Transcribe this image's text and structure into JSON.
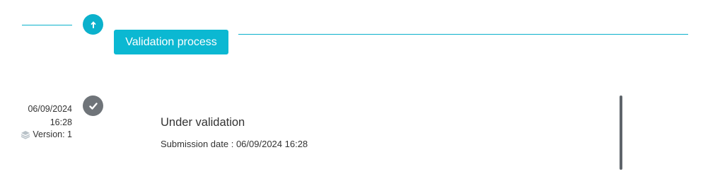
{
  "header": {
    "process_label": "Validation process",
    "accent_color": "#0bb1cc",
    "step_icon": "arrow-up-icon"
  },
  "entry": {
    "date": "06/09/2024",
    "time": "16:28",
    "version": "Version: 1",
    "version_icon": "layers-icon",
    "status_icon": "check-icon",
    "status": "Under validation",
    "submission": "Submission date : 06/09/2024 16:28"
  }
}
